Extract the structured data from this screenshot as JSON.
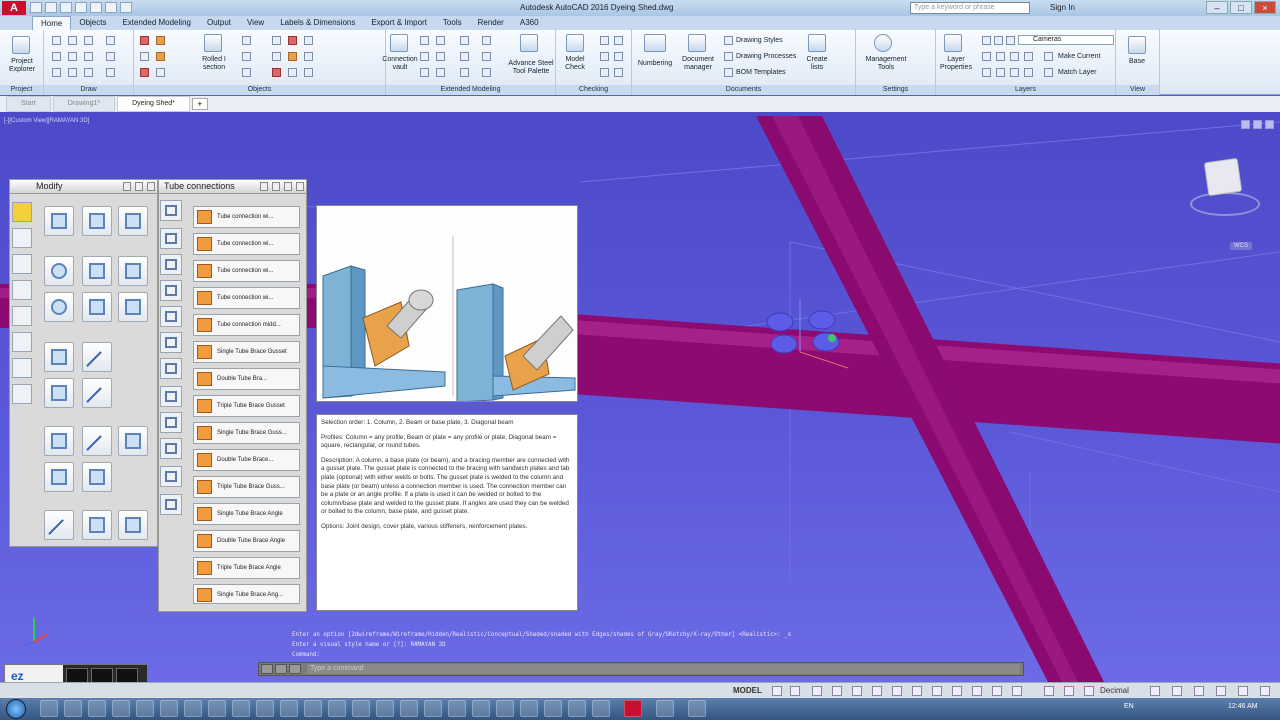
{
  "window": {
    "logo": "A",
    "title": "Autodesk AutoCAD 2016   Dyeing Shed.dwg",
    "search_placeholder": "Type a keyword or phrase",
    "sign_in": "Sign In"
  },
  "ribbon": {
    "tabs": [
      "Home",
      "Objects",
      "Extended Modeling",
      "Output",
      "View",
      "Labels & Dimensions",
      "Export & Import",
      "Tools",
      "Render",
      "A360"
    ],
    "active_tab": "Home",
    "panels": {
      "project": "Project",
      "draw": "Draw",
      "objects": "Objects",
      "extended_modeling": "Extended Modeling",
      "checking": "Checking",
      "documents": "Documents",
      "settings": "Settings",
      "layers": "Layers",
      "view": "View"
    },
    "buttons": {
      "project_explorer": "Project Explorer",
      "rolled_i_section": "Rolled I section",
      "connection_vault": "Connection vault",
      "advance_steel_tool_palette": "Advance Steel Tool Palette",
      "model_check": "Model Check",
      "numbering": "Numbering",
      "document_manager": "Document manager",
      "drawing_styles": "Drawing Styles",
      "drawing_processes": "Drawing Processes",
      "bom_templates": "BOM Templates",
      "create_lists": "Create lists",
      "management_tools": "Management Tools",
      "layer_properties": "Layer Properties",
      "make_current": "Make Current",
      "match_layer": "Match Layer",
      "base": "Base",
      "layer_dropdown": "Cameras"
    }
  },
  "doc_tabs": [
    "Start",
    "Drawing1*",
    "Dyeing Shed*"
  ],
  "active_doc_tab": "Dyeing Shed*",
  "viewport": {
    "label": "[-][Custom View][RAMAYAN 3D]",
    "wcs": "WCS"
  },
  "modify_palette": {
    "title": "Modify"
  },
  "tube_palette": {
    "title": "Tube connections",
    "items": [
      "Tube connection wi...",
      "Tube connection wi...",
      "Tube connection wi...",
      "Tube connection wi...",
      "Tube connection midd...",
      "Single Tube Brace Gusset",
      "Double Tube Bra...",
      "Triple Tube Brace Gusset",
      "Single Tube Brace Guss...",
      "Double Tube Brace...",
      "Triple Tube Brace Guss...",
      "Single Tube Brace Angle",
      "Double Tube Brace Angle",
      "Triple Tube Brace Angle",
      "Single Tube Brace Ang..."
    ]
  },
  "description": {
    "selection": "Selection order: 1. Column, 2. Beam or base plate, 3. Diagonal beam",
    "profiles": "Profiles: Column = any profile; Beam or plate = any profile or plate; Diagonal beam = square, rectangular, or round tubes.",
    "description": "Description: A column, a base plate (or beam), and a bracing member are connected with a gusset plate. The gusset plate is connected to the bracing with sandwich plates and tab plate (optional) with either welds or bolts. The gusset plate is welded to the column and base plate (or beam) unless a connection member is used. The connection member can be a plate or an angle profile. If a plate is used it can be welded or bolted to the column/base plate and welded to the gusset plate. If angles are used they can be welded or bolted to the column, base plate, and gusset plate.",
    "options": "Options: Joint design, cover plate, various stiffeners, reinforcement plates."
  },
  "command": {
    "history_1": "Enter an option [2dwireframe/Wireframe/Hidden/Realistic/Conceptual/Shaded/shaded with Edges/shades of Gray/SKetchy/X-ray/Other] <Realistic>: _s",
    "history_2": "Enter a visual style name or [?]: RAMAYAN 3D",
    "history_3": "Command:",
    "placeholder": "Type a command"
  },
  "logo": {
    "text": "ez"
  },
  "statusbar": {
    "model": "MODEL",
    "units": "Decimal"
  },
  "taskbar": {
    "lang": "EN",
    "clock": "12:46 AM"
  },
  "colors": {
    "steel_magenta": "#9a0d7a",
    "viewport_blue": "#5b59d8",
    "gusset_orange": "#e8a24a",
    "bolt_blue": "#5c5ce8"
  }
}
